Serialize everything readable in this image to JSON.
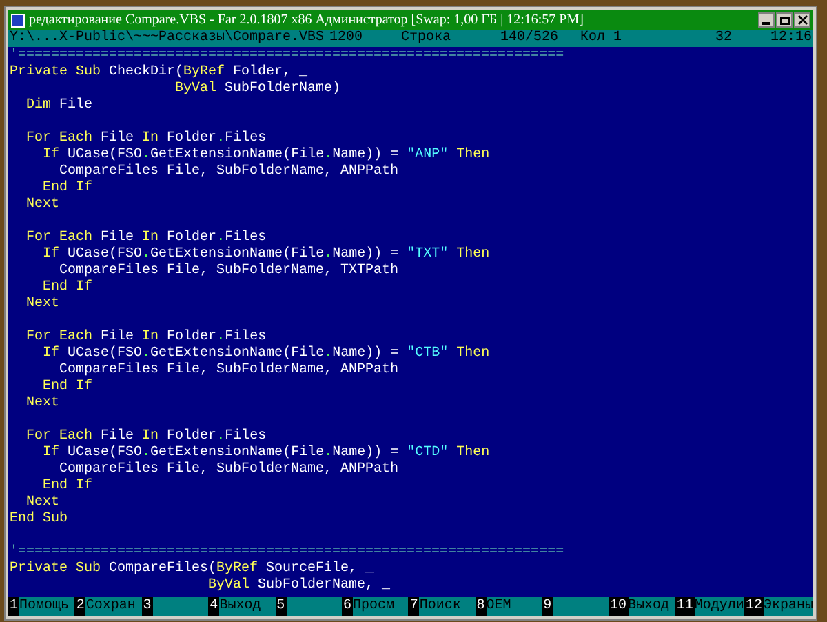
{
  "window": {
    "title": "редактирование Compare.VBS - Far 2.0.1807 x86 Администратор [Swap: 1,00 ГБ | 12:16:57 PM]"
  },
  "status_bar": {
    "path": "Y:\\...X-Public\\~~~Рассказы\\Compare.VBS",
    "code_page": "1200",
    "line_label": "Строка",
    "line_position": "140/526",
    "column": "Кол 1",
    "char_code": "32",
    "clock": "12:16"
  },
  "editor": {
    "lines": [
      {
        "kind": "code",
        "segments": [
          {
            "kind": "comment",
            "text": "'=================================================================="
          }
        ]
      },
      {
        "kind": "code",
        "segments": [
          {
            "kind": "keyword",
            "text": "Private Sub "
          },
          {
            "kind": "plain",
            "text": "CheckDir("
          },
          {
            "kind": "keyword",
            "text": "ByRef"
          },
          {
            "kind": "plain",
            "text": " Folder, _"
          }
        ]
      },
      {
        "kind": "code",
        "segments": [
          {
            "kind": "keyword",
            "text": "                    ByVal"
          },
          {
            "kind": "plain",
            "text": " SubFolderName)"
          }
        ]
      },
      {
        "kind": "code",
        "segments": [
          {
            "kind": "keyword",
            "text": "  Dim"
          },
          {
            "kind": "plain",
            "text": " File"
          }
        ]
      },
      {
        "kind": "blank"
      },
      {
        "kind": "code",
        "segments": [
          {
            "kind": "keyword",
            "text": "  For Each"
          },
          {
            "kind": "plain",
            "text": " File "
          },
          {
            "kind": "keyword",
            "text": "In"
          },
          {
            "kind": "plain",
            "text": " Folder"
          },
          {
            "kind": "operator",
            "text": "."
          },
          {
            "kind": "plain",
            "text": "Files"
          }
        ]
      },
      {
        "kind": "code",
        "segments": [
          {
            "kind": "keyword",
            "text": "    If"
          },
          {
            "kind": "plain",
            "text": " UCase(FSO"
          },
          {
            "kind": "operator",
            "text": "."
          },
          {
            "kind": "plain",
            "text": "GetExtensionName(File"
          },
          {
            "kind": "operator",
            "text": "."
          },
          {
            "kind": "plain",
            "text": "Name)) = "
          },
          {
            "kind": "string",
            "text": "\"ANP\""
          },
          {
            "kind": "keyword",
            "text": " Then"
          }
        ]
      },
      {
        "kind": "code",
        "segments": [
          {
            "kind": "plain",
            "text": "      CompareFiles File, SubFolderName, ANPPath"
          }
        ]
      },
      {
        "kind": "code",
        "segments": [
          {
            "kind": "keyword",
            "text": "    End If"
          }
        ]
      },
      {
        "kind": "code",
        "segments": [
          {
            "kind": "keyword",
            "text": "  Next"
          }
        ]
      },
      {
        "kind": "blank"
      },
      {
        "kind": "code",
        "segments": [
          {
            "kind": "keyword",
            "text": "  For Each"
          },
          {
            "kind": "plain",
            "text": " File "
          },
          {
            "kind": "keyword",
            "text": "In"
          },
          {
            "kind": "plain",
            "text": " Folder"
          },
          {
            "kind": "operator",
            "text": "."
          },
          {
            "kind": "plain",
            "text": "Files"
          }
        ]
      },
      {
        "kind": "code",
        "segments": [
          {
            "kind": "keyword",
            "text": "    If"
          },
          {
            "kind": "plain",
            "text": " UCase(FSO"
          },
          {
            "kind": "operator",
            "text": "."
          },
          {
            "kind": "plain",
            "text": "GetExtensionName(File"
          },
          {
            "kind": "operator",
            "text": "."
          },
          {
            "kind": "plain",
            "text": "Name)) = "
          },
          {
            "kind": "string",
            "text": "\"TXT\""
          },
          {
            "kind": "keyword",
            "text": " Then"
          }
        ]
      },
      {
        "kind": "code",
        "segments": [
          {
            "kind": "plain",
            "text": "      CompareFiles File, SubFolderName, TXTPath"
          }
        ]
      },
      {
        "kind": "code",
        "segments": [
          {
            "kind": "keyword",
            "text": "    End If"
          }
        ]
      },
      {
        "kind": "code",
        "segments": [
          {
            "kind": "keyword",
            "text": "  Next"
          }
        ]
      },
      {
        "kind": "blank"
      },
      {
        "kind": "code",
        "segments": [
          {
            "kind": "keyword",
            "text": "  For Each"
          },
          {
            "kind": "plain",
            "text": " File "
          },
          {
            "kind": "keyword",
            "text": "In"
          },
          {
            "kind": "plain",
            "text": " Folder"
          },
          {
            "kind": "operator",
            "text": "."
          },
          {
            "kind": "plain",
            "text": "Files"
          }
        ]
      },
      {
        "kind": "code",
        "segments": [
          {
            "kind": "keyword",
            "text": "    If"
          },
          {
            "kind": "plain",
            "text": " UCase(FSO"
          },
          {
            "kind": "operator",
            "text": "."
          },
          {
            "kind": "plain",
            "text": "GetExtensionName(File"
          },
          {
            "kind": "operator",
            "text": "."
          },
          {
            "kind": "plain",
            "text": "Name)) = "
          },
          {
            "kind": "string",
            "text": "\"CTB\""
          },
          {
            "kind": "keyword",
            "text": " Then"
          }
        ]
      },
      {
        "kind": "code",
        "segments": [
          {
            "kind": "plain",
            "text": "      CompareFiles File, SubFolderName, ANPPath"
          }
        ]
      },
      {
        "kind": "code",
        "segments": [
          {
            "kind": "keyword",
            "text": "    End If"
          }
        ]
      },
      {
        "kind": "code",
        "segments": [
          {
            "kind": "keyword",
            "text": "  Next"
          }
        ]
      },
      {
        "kind": "blank"
      },
      {
        "kind": "code",
        "segments": [
          {
            "kind": "keyword",
            "text": "  For Each"
          },
          {
            "kind": "plain",
            "text": " File "
          },
          {
            "kind": "keyword",
            "text": "In"
          },
          {
            "kind": "plain",
            "text": " Folder"
          },
          {
            "kind": "operator",
            "text": "."
          },
          {
            "kind": "plain",
            "text": "Files"
          }
        ]
      },
      {
        "kind": "code",
        "segments": [
          {
            "kind": "keyword",
            "text": "    If"
          },
          {
            "kind": "plain",
            "text": " UCase(FSO"
          },
          {
            "kind": "operator",
            "text": "."
          },
          {
            "kind": "plain",
            "text": "GetExtensionName(File"
          },
          {
            "kind": "operator",
            "text": "."
          },
          {
            "kind": "plain",
            "text": "Name)) = "
          },
          {
            "kind": "string",
            "text": "\"CTD\""
          },
          {
            "kind": "keyword",
            "text": " Then"
          }
        ]
      },
      {
        "kind": "code",
        "segments": [
          {
            "kind": "plain",
            "text": "      CompareFiles File, SubFolderName, ANPPath"
          }
        ]
      },
      {
        "kind": "code",
        "segments": [
          {
            "kind": "keyword",
            "text": "    End If"
          }
        ]
      },
      {
        "kind": "code",
        "segments": [
          {
            "kind": "keyword",
            "text": "  Next"
          }
        ]
      },
      {
        "kind": "code",
        "segments": [
          {
            "kind": "keyword",
            "text": "End Sub"
          }
        ]
      },
      {
        "kind": "blank"
      },
      {
        "kind": "code",
        "segments": [
          {
            "kind": "comment",
            "text": "'=================================================================="
          }
        ]
      },
      {
        "kind": "code",
        "segments": [
          {
            "kind": "keyword",
            "text": "Private Sub "
          },
          {
            "kind": "plain",
            "text": "CompareFiles("
          },
          {
            "kind": "keyword",
            "text": "ByRef"
          },
          {
            "kind": "plain",
            "text": " SourceFile, _"
          }
        ]
      },
      {
        "kind": "code",
        "segments": [
          {
            "kind": "keyword",
            "text": "                        ByVal"
          },
          {
            "kind": "plain",
            "text": " SubFolderName, _"
          }
        ]
      }
    ]
  },
  "key_bar": [
    {
      "number": "1",
      "label": "Помощь"
    },
    {
      "number": "2",
      "label": "Сохран"
    },
    {
      "number": "3"
    },
    {
      "number": "4",
      "label": "Выход"
    },
    {
      "number": "5"
    },
    {
      "number": "6",
      "label": "Просм"
    },
    {
      "number": "7",
      "label": "Поиск"
    },
    {
      "number": "8",
      "label": "OEM"
    },
    {
      "number": "9"
    },
    {
      "number": "10",
      "label": "Выход"
    },
    {
      "number": "11",
      "label": "Модули"
    },
    {
      "number": "12",
      "label": "Экраны"
    }
  ]
}
